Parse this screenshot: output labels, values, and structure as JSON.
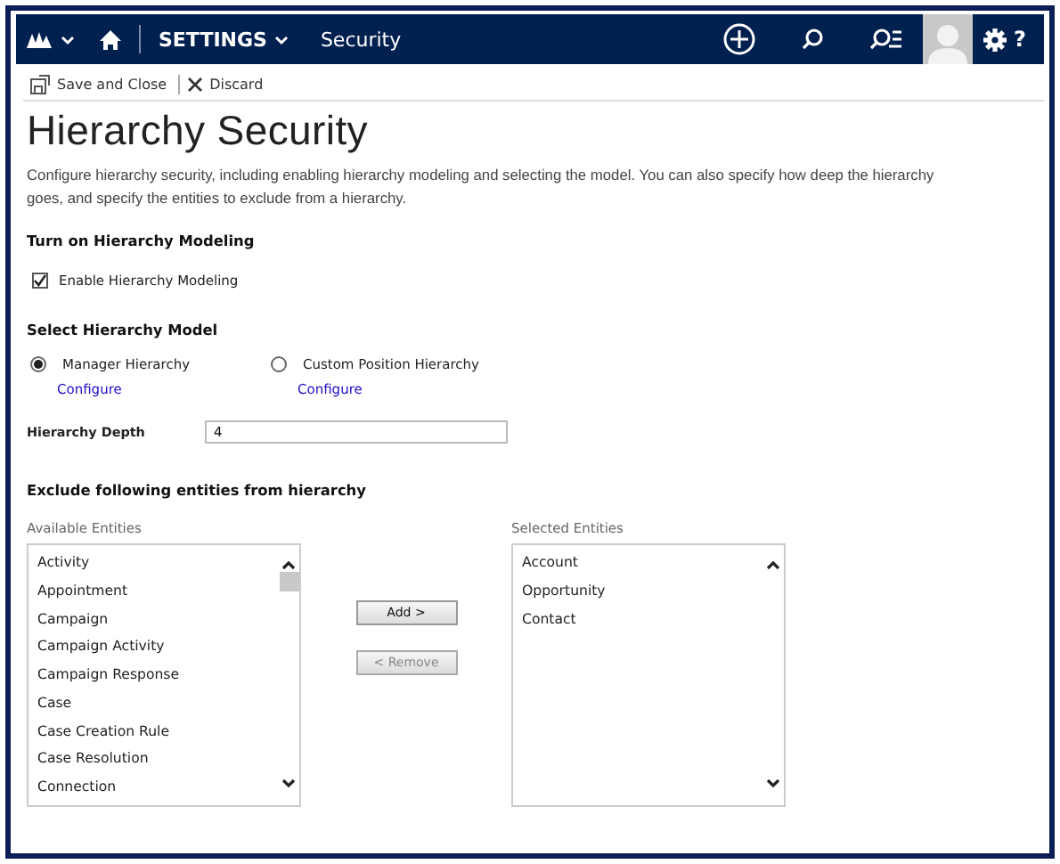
{
  "nav": {
    "area": "SETTINGS",
    "page": "Security",
    "help": "?"
  },
  "toolbar": [
    {
      "label": "Save and Close",
      "kind": "save"
    },
    {
      "label": "Discard",
      "kind": "discard"
    }
  ],
  "title": "Hierarchy Security",
  "description": "Configure hierarchy security, including enabling hierarchy modeling and selecting the model. You can also specify how deep the hierarchy goes, and specify the entities to exclude from a hierarchy.",
  "modeling": {
    "heading": "Turn on Hierarchy Modeling",
    "label": "Enable Hierarchy Modeling",
    "checked": true
  },
  "model": {
    "heading": "Select Hierarchy Model",
    "options": [
      {
        "label": "Manager Hierarchy",
        "link": "Configure",
        "selected": true
      },
      {
        "label": "Custom Position Hierarchy",
        "link": "Configure",
        "selected": false
      }
    ]
  },
  "depth": {
    "label": "Hierarchy Depth",
    "value": "4"
  },
  "exclude": {
    "heading": "Exclude following entities from hierarchy",
    "available": {
      "label": "Available Entities",
      "items": [
        "Activity",
        "Appointment",
        "Campaign",
        "Campaign Activity",
        "Campaign Response",
        "Case",
        "Case Creation Rule",
        "Case Resolution",
        "Connection"
      ]
    },
    "buttons": [
      {
        "label": "Add >",
        "disabled": false
      },
      {
        "label": "< Remove",
        "disabled": true
      }
    ],
    "selected": {
      "label": "Selected Entities",
      "items": [
        "Account",
        "Opportunity",
        "Contact"
      ]
    }
  }
}
